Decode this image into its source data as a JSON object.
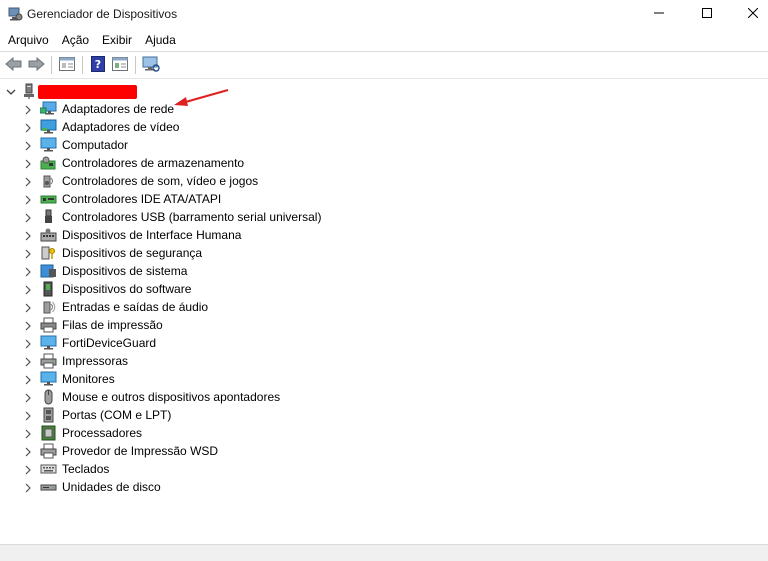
{
  "window": {
    "title": "Gerenciador de Dispositivos"
  },
  "menu": {
    "items": [
      "Arquivo",
      "Ação",
      "Exibir",
      "Ajuda"
    ]
  },
  "toolbar": {
    "buttons": [
      "back-arrow-icon",
      "forward-arrow-icon",
      "properties-icon",
      "help-icon",
      "update-driver-icon",
      "scan-hardware-icon"
    ]
  },
  "tree": {
    "root_name_redacted": true,
    "items": [
      {
        "label": "Adaptadores de rede",
        "icon": "network-adapter-icon"
      },
      {
        "label": "Adaptadores de vídeo",
        "icon": "display-adapter-icon"
      },
      {
        "label": "Computador",
        "icon": "computer-icon"
      },
      {
        "label": "Controladores de armazenamento",
        "icon": "storage-controller-icon"
      },
      {
        "label": "Controladores de som, vídeo e jogos",
        "icon": "speaker-icon"
      },
      {
        "label": "Controladores IDE ATA/ATAPI",
        "icon": "ide-controller-icon"
      },
      {
        "label": "Controladores USB (barramento serial universal)",
        "icon": "usb-icon"
      },
      {
        "label": "Dispositivos de Interface Humana",
        "icon": "hid-icon"
      },
      {
        "label": "Dispositivos de segurança",
        "icon": "security-key-icon"
      },
      {
        "label": "Dispositivos de sistema",
        "icon": "system-device-icon"
      },
      {
        "label": "Dispositivos do software",
        "icon": "software-device-icon"
      },
      {
        "label": "Entradas e saídas de áudio",
        "icon": "audio-io-icon"
      },
      {
        "label": "Filas de impressão",
        "icon": "print-queue-icon"
      },
      {
        "label": "FortiDeviceGuard",
        "icon": "forti-device-icon"
      },
      {
        "label": "Impressoras",
        "icon": "printer-icon"
      },
      {
        "label": "Monitores",
        "icon": "monitor-icon"
      },
      {
        "label": "Mouse e outros dispositivos apontadores",
        "icon": "mouse-icon"
      },
      {
        "label": "Portas (COM e LPT)",
        "icon": "port-icon"
      },
      {
        "label": "Processadores",
        "icon": "processor-icon"
      },
      {
        "label": "Provedor de Impressão WSD",
        "icon": "wsd-printer-icon"
      },
      {
        "label": "Teclados",
        "icon": "keyboard-icon"
      },
      {
        "label": "Unidades de disco",
        "icon": "disk-drive-icon"
      }
    ]
  },
  "colors": {
    "redaction": "#ff0000",
    "annotation_arrow": "#e02020"
  }
}
